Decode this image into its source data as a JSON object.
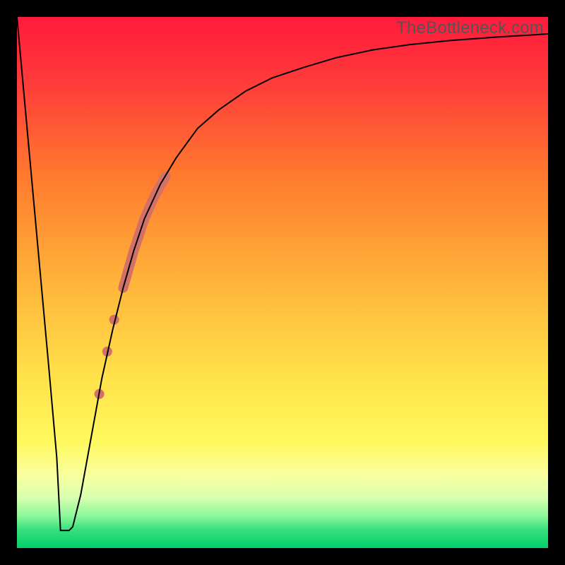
{
  "watermark": "TheBottleneck.com",
  "chart_data": {
    "type": "line",
    "title": "",
    "xlabel": "",
    "ylabel": "",
    "xlim": [
      0,
      100
    ],
    "ylim": [
      0,
      100
    ],
    "background_gradient": {
      "stops": [
        {
          "offset": 0.0,
          "color": "#ff1a3c"
        },
        {
          "offset": 0.12,
          "color": "#ff3a3a"
        },
        {
          "offset": 0.3,
          "color": "#ff7a2e"
        },
        {
          "offset": 0.5,
          "color": "#ffb43a"
        },
        {
          "offset": 0.68,
          "color": "#ffe24a"
        },
        {
          "offset": 0.8,
          "color": "#fff95e"
        },
        {
          "offset": 0.865,
          "color": "#f8ffa0"
        },
        {
          "offset": 0.905,
          "color": "#d8ffb0"
        },
        {
          "offset": 0.94,
          "color": "#8af79a"
        },
        {
          "offset": 0.965,
          "color": "#38e07e"
        },
        {
          "offset": 1.0,
          "color": "#00d06a"
        }
      ]
    },
    "series": [
      {
        "name": "bottleneck-curve",
        "color": "#000000",
        "stroke_width": 2,
        "x": [
          0.0,
          2.0,
          4.0,
          6.0,
          7.5,
          8.5,
          9.5,
          10.5,
          12.0,
          14.0,
          16.0,
          18.0,
          20.0,
          22.0,
          24.0,
          27.0,
          30.0,
          34.0,
          38.0,
          43.0,
          48.0,
          54.0,
          60.0,
          67.0,
          74.0,
          82.0,
          90.0,
          100.0
        ],
        "y": [
          100.0,
          78.0,
          56.0,
          34.0,
          17.0,
          7.0,
          3.5,
          4.0,
          10.0,
          21.0,
          32.0,
          41.0,
          49.0,
          56.0,
          62.0,
          68.5,
          73.5,
          79.0,
          82.5,
          86.0,
          88.5,
          90.5,
          92.3,
          93.8,
          94.8,
          95.6,
          96.2,
          96.8
        ]
      }
    ],
    "highlight_band": {
      "name": "thick-segment",
      "color": "#d37068",
      "stroke_width": 14,
      "x": [
        20.0,
        22.0,
        24.0,
        26.0,
        28.0
      ],
      "y": [
        49.0,
        56.0,
        62.0,
        66.5,
        70.0
      ]
    },
    "highlight_dots": {
      "name": "dots",
      "color": "#d37068",
      "radius": 7,
      "points": [
        {
          "x": 18.3,
          "y": 43.0
        },
        {
          "x": 17.0,
          "y": 37.0
        },
        {
          "x": 15.5,
          "y": 29.0
        }
      ]
    },
    "flat_bottom": {
      "x": [
        8.2,
        9.8
      ],
      "y": 3.3
    }
  }
}
